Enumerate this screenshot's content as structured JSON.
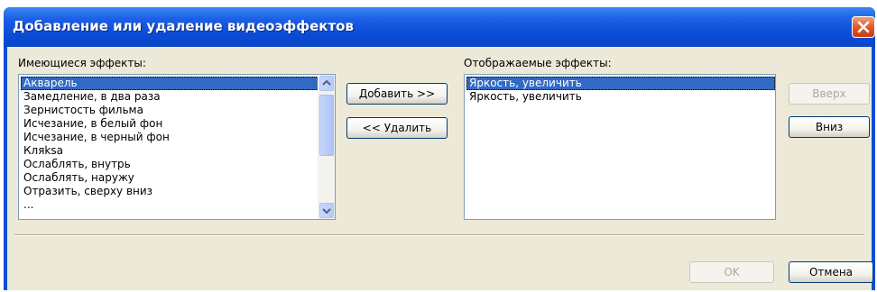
{
  "window": {
    "title": "Добавление или удаление видеоэффектов"
  },
  "available": {
    "label": "Имеющиеся эффекты:",
    "items": [
      "Акварель",
      "Замедление, в два раза",
      "Зернистость фильма",
      "Исчезание, в белый фон",
      "Исчезание, в черный фон",
      "Кляksa",
      "Ослаблять, внутрь",
      "Ослаблять, наружу",
      "Отразить, сверху вниз",
      "..."
    ],
    "selected_index": 0
  },
  "displayed": {
    "label": "Отображаемые эффекты:",
    "items": [
      "Яркость, увеличить",
      "Яркость, увеличить"
    ],
    "selected_index": 0
  },
  "buttons": {
    "add": "Добавить >>",
    "remove": "<< Удалить",
    "up": "Вверх",
    "down": "Вниз",
    "ok": "OK",
    "cancel": "Отмена"
  }
}
